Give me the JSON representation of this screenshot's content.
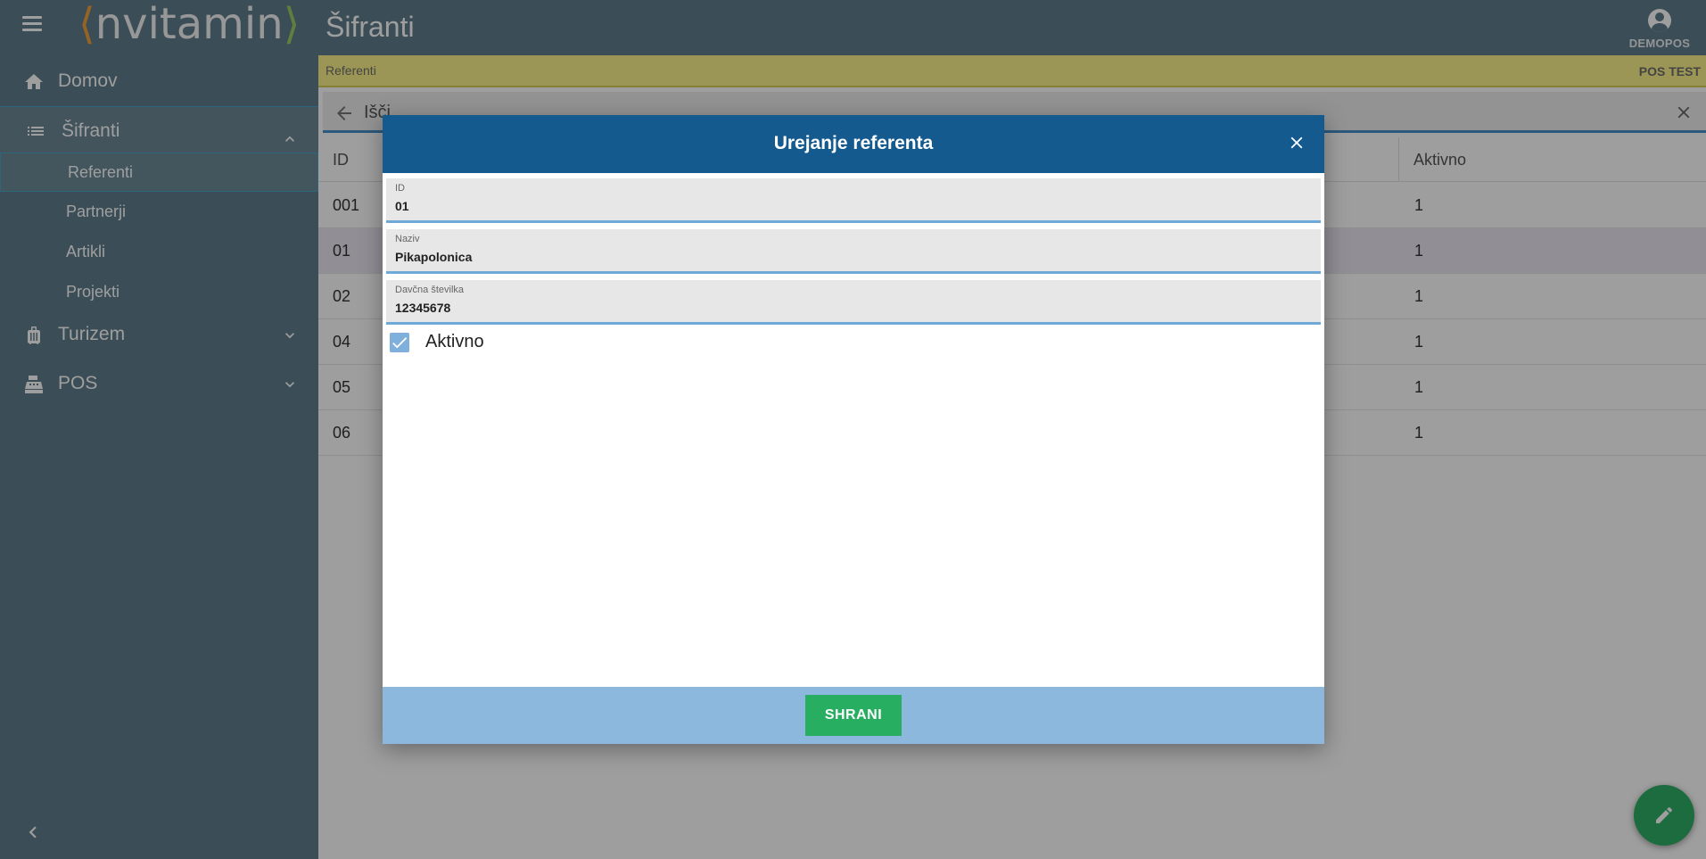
{
  "app": {
    "logo_text": "nvitamin",
    "logo_open": "⟨",
    "logo_close": "⟩",
    "page_title": "Šifranti",
    "user_name": "DEMOPOS"
  },
  "sidebar": {
    "items": [
      {
        "label": "Domov",
        "icon": "home-icon"
      },
      {
        "label": "Šifranti",
        "icon": "list-icon",
        "expanded": true
      },
      {
        "label": "Turizem",
        "icon": "luggage-icon"
      },
      {
        "label": "POS",
        "icon": "cash-register-icon"
      }
    ],
    "sub_items": [
      {
        "label": "Referenti",
        "active": true
      },
      {
        "label": "Partnerji"
      },
      {
        "label": "Artikli"
      },
      {
        "label": "Projekti"
      }
    ]
  },
  "banner": {
    "breadcrumb": "Referenti",
    "env": "POS TEST"
  },
  "search": {
    "placeholder": "Išči"
  },
  "grid": {
    "columns": [
      "ID",
      "Aktivno"
    ],
    "rows": [
      {
        "id": "001",
        "aktivno": "1"
      },
      {
        "id": "01",
        "aktivno": "1",
        "selected": true
      },
      {
        "id": "02",
        "aktivno": "1"
      },
      {
        "id": "04",
        "aktivno": "1"
      },
      {
        "id": "05",
        "aktivno": "1"
      },
      {
        "id": "06",
        "aktivno": "1"
      }
    ]
  },
  "modal": {
    "title": "Urejanje referenta",
    "fields": [
      {
        "label": "ID",
        "value": "01"
      },
      {
        "label": "Naziv",
        "value": "Pikapolonica"
      },
      {
        "label": "Davčna številka",
        "value": "12345678"
      }
    ],
    "active_label": "Aktivno",
    "active_checked": true,
    "save_label": "SHRANI"
  },
  "colors": {
    "header": "#607d8b",
    "modal_header": "#155a8e",
    "modal_footer": "#8cb8de",
    "save_button": "#27ae60",
    "banner": "#fbf38a",
    "fab": "#2fae66"
  }
}
